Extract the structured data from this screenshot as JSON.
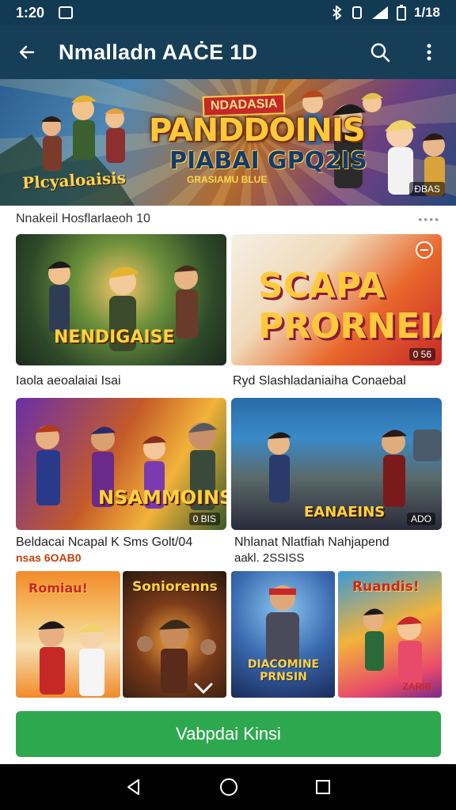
{
  "status_bar": {
    "time": "1:20",
    "right_time": "1/18"
  },
  "app_bar": {
    "title": "Nmalladn AAĊE 1D"
  },
  "banner": {
    "kicker": "NDADASIA",
    "title": "PANDDOINIS",
    "subtitle": "PIABAI GPQ2IS",
    "small_text": "GRASIAMU BLUE",
    "left_text": "Plcyaloaisis",
    "badge": "ĐBAS"
  },
  "section": {
    "title": "Nnakeil Hosflarlaeoh 10",
    "more_dots": "••••"
  },
  "grid": [
    {
      "caption": "NENDIGAISE",
      "label": "Iaola aeoalaiai Isai",
      "sublabel": "",
      "badge": ""
    },
    {
      "caption": "SCAPA PRORNEIAIS",
      "label": "Ryd Slashladaniaiha Conaebal",
      "sublabel": "",
      "badge": "0 56"
    },
    {
      "caption": "NSAMMOINS",
      "label": "Beldacai Ncapal K Sms Golt/04",
      "sublabel": "nsas 6OAB0",
      "badge": "0 BIS"
    },
    {
      "caption": "EANAEINS",
      "label": "Nhlanat Nlatfiah Nahjapend",
      "sublabel": "aakl. 2SSISS",
      "badge": "ADO"
    }
  ],
  "tiles": [
    {
      "caption": "Romiau!"
    },
    {
      "caption": "Soniorenns"
    },
    {
      "caption": "DIACOMINE PRNSIN"
    },
    {
      "caption": "Ruandis!"
    }
  ],
  "tile_4_badge": "ZARIB",
  "cta": {
    "label": "Vabpdai Kinsi"
  }
}
